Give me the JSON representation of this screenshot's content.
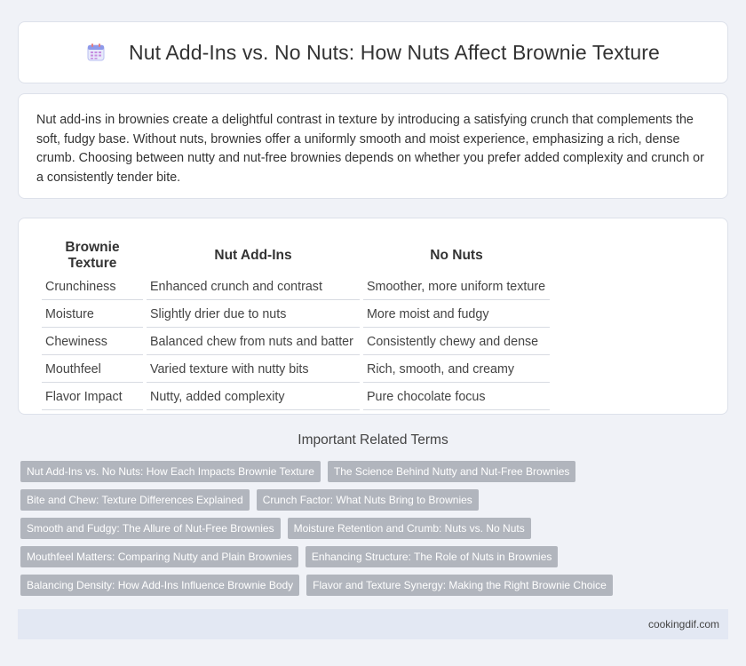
{
  "header": {
    "title": "Nut Add-Ins vs. No Nuts: How Nuts Affect Brownie Texture",
    "icon": "calendar-icon"
  },
  "intro": {
    "text": "Nut add-ins in brownies create a delightful contrast in texture by introducing a satisfying crunch that complements the soft, fudgy base. Without nuts, brownies offer a uniformly smooth and moist experience, emphasizing a rich, dense crumb. Choosing between nutty and nut-free brownies depends on whether you prefer added complexity and crunch or a consistently tender bite."
  },
  "table": {
    "headers": [
      "Brownie Texture",
      "Nut Add-Ins",
      "No Nuts"
    ],
    "rows": [
      [
        "Crunchiness",
        "Enhanced crunch and contrast",
        "Smoother, more uniform texture"
      ],
      [
        "Moisture",
        "Slightly drier due to nuts",
        "More moist and fudgy"
      ],
      [
        "Chewiness",
        "Balanced chew from nuts and batter",
        "Consistently chewy and dense"
      ],
      [
        "Mouthfeel",
        "Varied texture with nutty bits",
        "Rich, smooth, and creamy"
      ],
      [
        "Flavor Impact",
        "Nutty, added complexity",
        "Pure chocolate focus"
      ]
    ]
  },
  "related": {
    "title": "Important Related Terms",
    "tags": [
      "Nut Add-Ins vs. No Nuts: How Each Impacts Brownie Texture",
      "The Science Behind Nutty and Nut-Free Brownies",
      "Bite and Chew: Texture Differences Explained",
      "Crunch Factor: What Nuts Bring to Brownies",
      "Smooth and Fudgy: The Allure of Nut-Free Brownies",
      "Moisture Retention and Crumb: Nuts vs. No Nuts",
      "Mouthfeel Matters: Comparing Nutty and Plain Brownies",
      "Enhancing Structure: The Role of Nuts in Brownies",
      "Balancing Density: How Add-Ins Influence Brownie Body",
      "Flavor and Texture Synergy: Making the Right Brownie Choice"
    ]
  },
  "footer": {
    "site": "cookingdif.com"
  },
  "colors": {
    "tag_bg": "#b1b5bd",
    "page_bg": "#f0f2f7",
    "footer_bg": "#e3e8f3"
  }
}
